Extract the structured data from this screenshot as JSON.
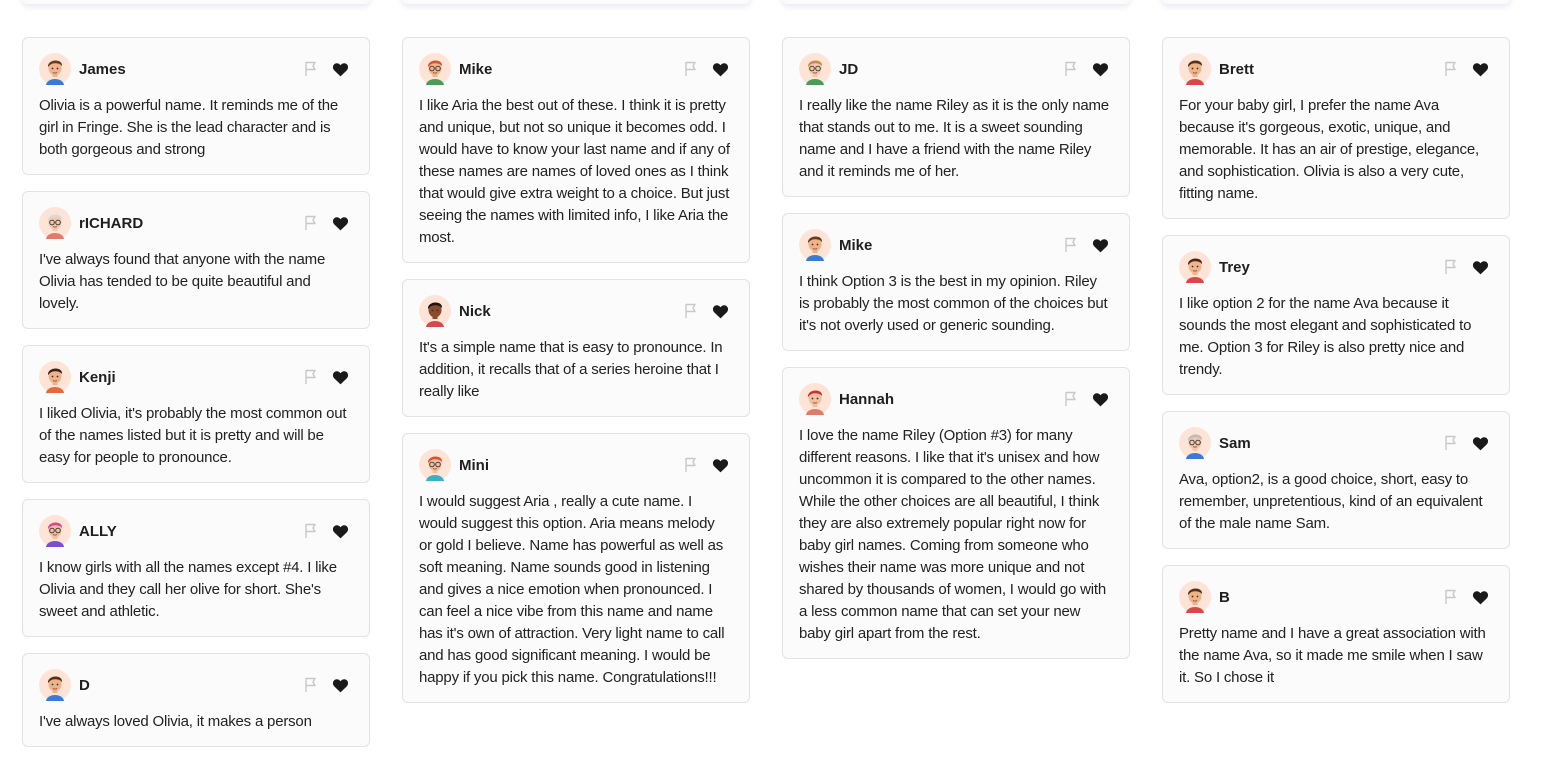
{
  "icons": {
    "flag": "flag-icon",
    "heart": "heart-icon"
  },
  "colors": {
    "card_bg": "#fbfbfb",
    "border": "#e3e3e3",
    "heart": "#1a1a1a",
    "flag": "#c8c8c8"
  },
  "columns": [
    [
      {
        "name": "James",
        "avatar": {
          "skin": "#f0b58e",
          "hair": "#6b3a1f",
          "shirt": "#3b7bd6",
          "glasses": false
        },
        "text": "Olivia is a powerful name. It reminds me of the girl in Fringe. She is the lead character and is both gorgeous and strong"
      },
      {
        "name": "rICHARD",
        "avatar": {
          "skin": "#f3c7a8",
          "hair": "#d9d9d9",
          "shirt": "#e07b6a",
          "glasses": true
        },
        "text": "I've always found that anyone with the name Olivia has tended to be quite beautiful and lovely."
      },
      {
        "name": "Kenji",
        "avatar": {
          "skin": "#efb38a",
          "hair": "#3a2418",
          "shirt": "#e56a3a",
          "glasses": false
        },
        "text": "I liked Olivia, it's probably the most common out of the names listed but it is pretty and will be easy for people to pronounce."
      },
      {
        "name": "ALLY",
        "avatar": {
          "skin": "#f2bfa0",
          "hair": "#e0438f",
          "shirt": "#7a4fd0",
          "glasses": true
        },
        "text": "I know girls with all the names except #4. I like Olivia and they call her olive for short. She's sweet and athletic."
      },
      {
        "name": "D",
        "avatar": {
          "skin": "#efb38a",
          "hair": "#5a2f1a",
          "shirt": "#3b7bd6",
          "glasses": false
        },
        "text": "I've always loved Olivia, it makes a person"
      }
    ],
    [
      {
        "name": "Mike",
        "avatar": {
          "skin": "#f0b58e",
          "hair": "#d4552b",
          "shirt": "#4a9a5a",
          "glasses": true
        },
        "text": "I like Aria the best out of these. I think it is pretty and unique, but not so unique it becomes odd. I would have to know your last name and if any of these names are names of loved ones as I think that would give extra weight to a choice. But just seeing the names with limited info, I like Aria the most."
      },
      {
        "name": "Nick",
        "avatar": {
          "skin": "#8b4a2b",
          "hair": "#1e1410",
          "shirt": "#d94848",
          "glasses": false
        },
        "text": "It's a simple name that is easy to pronounce. In addition, it recalls that of a series heroine that I really like"
      },
      {
        "name": "Mini",
        "avatar": {
          "skin": "#f2bfa0",
          "hair": "#e0502e",
          "shirt": "#3bb0c9",
          "glasses": true
        },
        "text": "I would suggest Aria , really a cute name. I would suggest this option. Aria means melody or gold I believe. Name has powerful as well as soft meaning. Name sounds good in listening and gives a nice emotion when pronounced. I can feel a nice vibe from this name and name has it's own of attraction. Very light name to call and has good significant meaning. I would be happy if you pick this name. Congratulations!!!"
      }
    ],
    [
      {
        "name": "JD",
        "avatar": {
          "skin": "#f3c7a8",
          "hair": "#c98a4a",
          "shirt": "#4a9a5a",
          "glasses": true
        },
        "text": "I really like the name Riley as it is the only name that stands out to me. It is a sweet sounding name and I have a friend with the name Riley and it reminds me of her."
      },
      {
        "name": "Mike",
        "avatar": {
          "skin": "#efb38a",
          "hair": "#6b3a1f",
          "shirt": "#3b7bd6",
          "glasses": false
        },
        "text": "I think Option 3 is the best in my opinion. Riley is probably the most common of the choices but it's not overly used or generic sounding."
      },
      {
        "name": "Hannah",
        "avatar": {
          "skin": "#f2bfa0",
          "hair": "#c8332a",
          "shirt": "#e07b6a",
          "glasses": false
        },
        "text": "I love the name Riley (Option #3) for many different reasons. I like that it's unisex and how uncommon it is compared to the other names. While the other choices are all beautiful, I think they are also extremely popular right now for baby girl names. Coming from someone who wishes their name was more unique and not shared by thousands of women, I would go with a less common name that can set your new baby girl apart from the rest."
      }
    ],
    [
      {
        "name": "Brett",
        "avatar": {
          "skin": "#efb38a",
          "hair": "#5a2f1a",
          "shirt": "#d94848",
          "glasses": false
        },
        "text": "For your baby girl, I prefer the name Ava because it's gorgeous, exotic, unique, and memorable. It has an air of prestige, elegance, and sophistication. Olivia is also a very cute, fitting name."
      },
      {
        "name": "Trey",
        "avatar": {
          "skin": "#f0b58e",
          "hair": "#4a2616",
          "shirt": "#d94848",
          "glasses": false
        },
        "text": "I like option 2 for the name Ava because it sounds the most elegant and sophisticated to me. Option 3 for Riley is also pretty nice and trendy."
      },
      {
        "name": "Sam",
        "avatar": {
          "skin": "#f3c7a8",
          "hair": "#bdbdbd",
          "shirt": "#3b7bd6",
          "glasses": true
        },
        "text": "Ava, option2, is a good choice, short, easy to remember, unpretentious, kind of an equivalent of the male name Sam."
      },
      {
        "name": "B",
        "avatar": {
          "skin": "#efb38a",
          "hair": "#5a2f1a",
          "shirt": "#d94848",
          "glasses": false
        },
        "text": "Pretty name and I have a great association with the name Ava, so it made me smile when I saw it. So I chose it"
      }
    ]
  ]
}
